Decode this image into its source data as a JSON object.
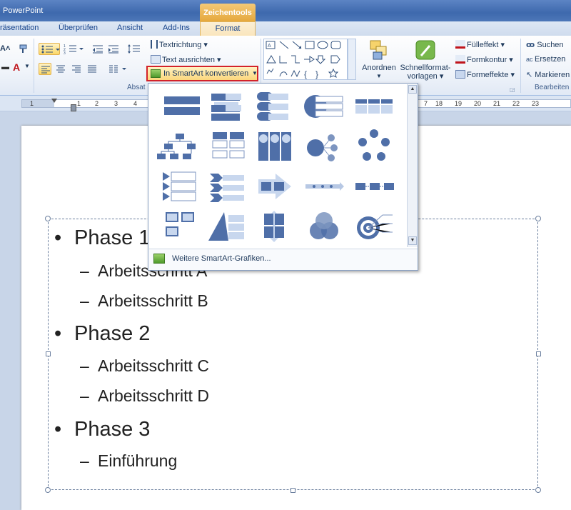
{
  "window": {
    "app_title": "PowerPoint",
    "context_tab_group": "Zeichentools"
  },
  "tabs": [
    "räsentation",
    "Überprüfen",
    "Ansicht",
    "Add-Ins",
    "Format"
  ],
  "ribbon": {
    "text_direction": "Textrichtung",
    "align_text": "Text ausrichten",
    "convert_smartart": "In SmartArt konvertieren",
    "group_paragraph": "Absat",
    "arrange": "Anordnen",
    "quick_styles_line1": "Schnellformat-",
    "quick_styles_line2": "vorlagen",
    "shape_fill": "Fülleffekt",
    "shape_outline": "Formkontur",
    "shape_effects": "Formeffekte",
    "find": "Suchen",
    "replace": "Ersetzen",
    "select": "Markieren",
    "group_editing": "Bearbeiten"
  },
  "ruler": {
    "left_numbers": [
      "1",
      "1",
      "2",
      "3",
      "4"
    ],
    "right_numbers": [
      "7",
      "18",
      "19",
      "20",
      "21",
      "22",
      "23"
    ]
  },
  "gallery": {
    "more_link": "Weitere SmartArt-Grafiken..."
  },
  "slide": {
    "bullets": [
      {
        "level": 1,
        "text": "Phase 1"
      },
      {
        "level": 2,
        "text": "Arbeitsschritt A"
      },
      {
        "level": 2,
        "text": "Arbeitsschritt B"
      },
      {
        "level": 1,
        "text": "Phase 2"
      },
      {
        "level": 2,
        "text": "Arbeitsschritt C"
      },
      {
        "level": 2,
        "text": "Arbeitsschritt D"
      },
      {
        "level": 1,
        "text": "Phase 3"
      },
      {
        "level": 2,
        "text": "Einführung"
      }
    ]
  },
  "colors": {
    "accent_blue": "#4f6fa8",
    "highlight_red": "#d3222a",
    "context_orange": "#e5a83d"
  }
}
